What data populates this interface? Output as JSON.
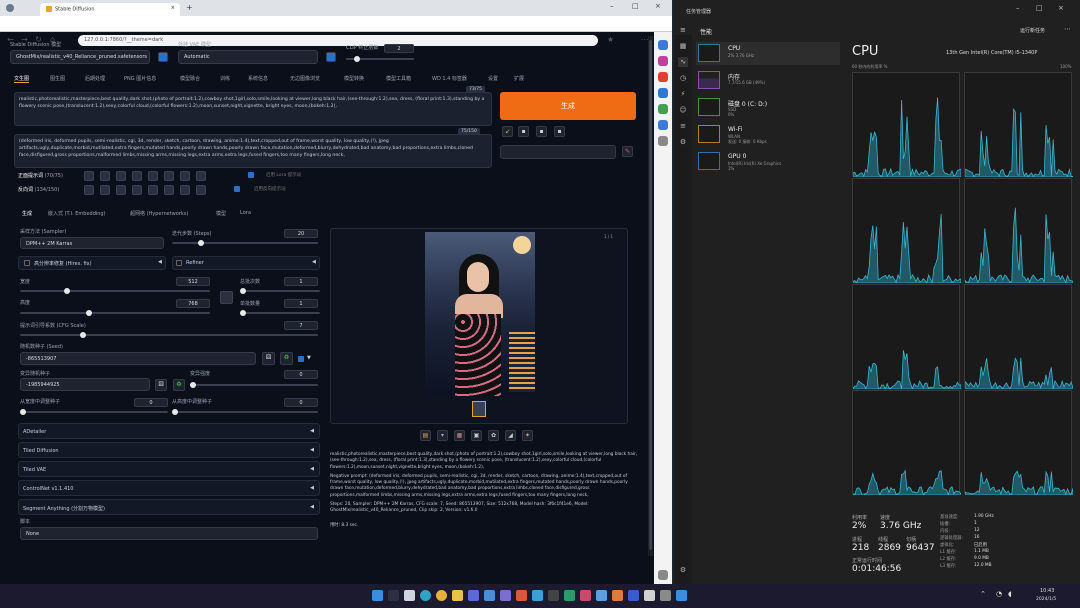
{
  "browser": {
    "tab_title": "Stable Diffusion",
    "url": "127.0.0.1:7860/?__theme=dark"
  },
  "webui": {
    "checkpoint_label": "Stable Diffusion 模型",
    "checkpoint_value": "GhostMix/realistic_v40_Reliance_pruned.safetensors",
    "vae_label": "外挂 VAE 模型",
    "vae_value": "Automatic",
    "clip_label": "CLIP 终止层数",
    "clip_value": "2",
    "tabs": [
      "文生图",
      "图生图",
      "后期处理",
      "PNG 图片信息",
      "模型融合",
      "训练",
      "系统信息",
      "无边图像浏览",
      "模型转换",
      "模型工具箱",
      "WD 1.4 标签器",
      "设置",
      "扩展"
    ],
    "positive_prompt": "realistic,photorealistic,masterpiece,best quality,dark shot,(photo of portrait:1.2),cowboy shot,1girl,solo,smile,looking at viewer,long black hair,(see-through:1.2),sea, dress, (floral print:1.3),standing by a flowery scenic pose,(translucent:1.2),sexy,colorful cloud,(colorful flowers:1.2),moon,sunset,night,vignette, bright eyes, moon,(bokeh:1.2),",
    "positive_counter": "73/75",
    "negative_prompt": "(deformed iris, deformed pupils, semi-realistic, cgi, 3d, render, sketch, cartoon, drawing, anime:1.4),text,cropped,out of frame,worst quality, low quality,(!), jpeg artifacts,ugly,duplicate,morbid,mutilated,extra fingers,mutated hands,poorly drawn hands,poorly drawn face,mutation,deformed,blurry,dehydrated,bad anatomy,bad proportions,extra limbs,cloned face,disfigured,gross proportions,malformed limbs,missing arms,missing legs,extra arms,extra legs,fused fingers,too many fingers,long neck,",
    "negative_counter": "75/150",
    "generate_label": "生成",
    "positive_word": "正面提示词",
    "positive_count": "(70/75)",
    "negative_word": "反向词",
    "negative_count": "(134/150)",
    "cb1_label": "启用 Lora 提示词",
    "cb2_label": "启用反向提示词",
    "subtabs": [
      "生成",
      "嵌入式 (T.I. Embedding)",
      "超网络 (Hypernetworks)",
      "模型",
      "Lora"
    ],
    "sampler_label": "采样方法 (Sampler)",
    "sampler_value": "DPM++ 2M Karras",
    "steps_label": "迭代步数 (Steps)",
    "steps_value": "20",
    "hires_label": "高分辨率修复 (Hires. fix)",
    "refiner_label": "Refiner",
    "width_label": "宽度",
    "width_value": "512",
    "height_label": "高度",
    "height_value": "768",
    "batch_count_label": "总批次数",
    "batch_count_value": "1",
    "batch_size_label": "单批数量",
    "batch_size_value": "1",
    "cfg_label": "提示词引导系数 (CFG Scale)",
    "cfg_value": "7",
    "seed_label": "随机数种子 (Seed)",
    "seed_value": "-865513907",
    "varseed_label": "变异随机种子",
    "varseed_value": "-1985944925",
    "varstrength_label": "变异强度",
    "varstrength_value": "0",
    "resize_w_label": "从宽度中调整种子",
    "resize_w_value": "0",
    "resize_h_label": "从高度中调整种子",
    "resize_h_value": "0",
    "accordions": [
      "ADetailer",
      "Tiled Diffusion",
      "Tiled VAE",
      "ControlNet v1.1.410",
      "Segment Anything (分割万物模型)"
    ],
    "script_label": "脚本",
    "script_value": "None",
    "info_prompt": "realistic,photorealistic,masterpiece,best quality,dark shot,(photo of portrait:1.2),cowboy shot,1girl,solo,smile,looking at viewer,long black hair,(see-through:1.2),sea, dress, (floral print:1.3),standing by a flowery scenic pose, (translucent:1.2),sexy,colorful cloud,(colorful flowers:1.2),moon,sunset,night,vignette,bright eyes, moon,(bokeh:1.2),",
    "info_negative": "Negative prompt: (deformed iris, deformed pupils, semi-realistic, cgi, 3d, render, sketch, cartoon, drawing, anime:1.4),text,cropped,out of frame,worst quality, low quality,(!), jpeg artifacts,ugly,duplicate,morbid,mutilated,extra fingers,mutated hands,poorly drawn hands,poorly drawn face,mutation,deformed,blurry,dehydrated,bad anatomy,bad proportions,extra limbs,cloned face,disfigured,gross proportions,malformed limbs,missing arms,missing legs,extra arms,extra legs,fused fingers,too many fingers,long neck,",
    "info_params": "Steps: 20, Sampler: DPM++ 2M Karras, CFG scale: 7, Seed: 865513907, Size: 512x768, Model hash: 3f6c1f41e6, Model: GhostMix/realistic_v40_Reliance_pruned, Clip skip: 2, Version: v1.6.0",
    "info_time": "用时: 8.3 sec.",
    "img_count": "1 / 1"
  },
  "taskmgr": {
    "title": "任务管理器",
    "section": "性能",
    "run_task": "运行新任务",
    "items": [
      {
        "name": "CPU",
        "sub": "2% 3.76 GHz"
      },
      {
        "name": "内存",
        "sub": "7.7/15.6 GB (49%)"
      },
      {
        "name": "磁盘 0 (C: D:)",
        "sub": "SSD\n0%"
      },
      {
        "name": "Wi-Fi",
        "sub": "WLAN\n发送: 0 接收: 0 Kbps"
      },
      {
        "name": "GPU 0",
        "sub": "Intel(R) Iris(R) Xe Graphics\n1%"
      }
    ],
    "cpu_title": "CPU",
    "cpu_model": "13th Gen Intel(R) Core(TM) i5-1340P",
    "graph_caption": "60 秒内的利用率 %",
    "graph_max": "100%",
    "utilization_label": "利用率",
    "utilization": "2%",
    "speed_label": "速度",
    "speed": "3.76 GHz",
    "processes_label": "进程",
    "processes": "218",
    "threads_label": "线程",
    "threads": "2869",
    "handles_label": "句柄",
    "handles": "96437",
    "uptime_label": "正常运行时间",
    "uptime": "0:01:46:56",
    "right_stats": [
      [
        "基准速度:",
        "1.90 GHz"
      ],
      [
        "插槽:",
        "1"
      ],
      [
        "内核:",
        "12"
      ],
      [
        "逻辑处理器:",
        "16"
      ],
      [
        "虚拟化:",
        "已启用"
      ],
      [
        "L1 缓存:",
        "1.1 MB"
      ],
      [
        "L2 缓存:",
        "9.0 MB"
      ],
      [
        "L3 缓存:",
        "12.0 MB"
      ]
    ]
  },
  "taskbar": {
    "time": "10:43",
    "date": "2024/1/5"
  }
}
